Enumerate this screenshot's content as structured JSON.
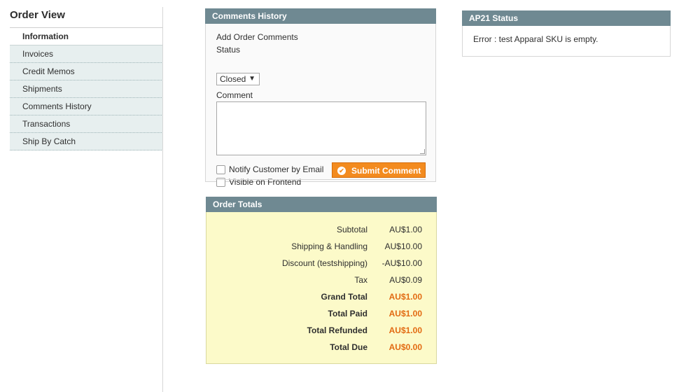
{
  "sidebar": {
    "title": "Order View",
    "tabs": [
      {
        "label": "Information",
        "active": true
      },
      {
        "label": "Invoices"
      },
      {
        "label": "Credit Memos"
      },
      {
        "label": "Shipments"
      },
      {
        "label": "Comments History"
      },
      {
        "label": "Transactions"
      },
      {
        "label": "Ship By Catch"
      }
    ]
  },
  "comments": {
    "header": "Comments History",
    "add_label": "Add Order Comments",
    "status_label": "Status",
    "status_value": "Closed",
    "comment_label": "Comment",
    "comment_value": "",
    "notify_label": "Notify Customer by Email",
    "visible_label": "Visible on Frontend",
    "submit_label": "Submit Comment"
  },
  "totals": {
    "header": "Order Totals",
    "rows": [
      {
        "label": "Subtotal",
        "value": "AU$1.00"
      },
      {
        "label": "Shipping & Handling",
        "value": "AU$10.00"
      },
      {
        "label": "Discount (testshipping)",
        "value": "-AU$10.00"
      },
      {
        "label": "Tax",
        "value": "AU$0.09"
      },
      {
        "label": "Grand Total",
        "value": "AU$1.00",
        "bold": true
      },
      {
        "label": "Total Paid",
        "value": "AU$1.00",
        "bold": true
      },
      {
        "label": "Total Refunded",
        "value": "AU$1.00",
        "bold": true
      },
      {
        "label": "Total Due",
        "value": "AU$0.00",
        "bold": true
      }
    ]
  },
  "ap21": {
    "header": "AP21 Status",
    "message": "Error : test Apparal SKU is empty."
  },
  "colors": {
    "panel_header": "#6f8992",
    "submit_button": "#f38b1f",
    "total_highlight": "#e26a12",
    "totals_background": "#fcfac9"
  }
}
